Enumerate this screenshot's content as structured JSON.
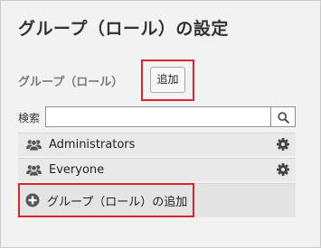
{
  "page": {
    "title": "グループ（ロール）の設定"
  },
  "section": {
    "label": "グループ（ロール）",
    "add_button_label": "追加"
  },
  "search": {
    "label": "検索",
    "value": "",
    "placeholder": "",
    "button_icon": "search-icon"
  },
  "groups": [
    {
      "name": "Administrators",
      "icon": "users-icon",
      "action_icon": "gear-icon"
    },
    {
      "name": "Everyone",
      "icon": "users-icon",
      "action_icon": "gear-icon"
    }
  ],
  "add_group": {
    "label": "グループ（ロール）の追加",
    "icon": "plus-circle-icon"
  },
  "colors": {
    "panel_background": "#f2f2f2",
    "list_row_background": "#e9e9e9",
    "icon_color": "#555555",
    "highlight_border": "#d9262b"
  }
}
